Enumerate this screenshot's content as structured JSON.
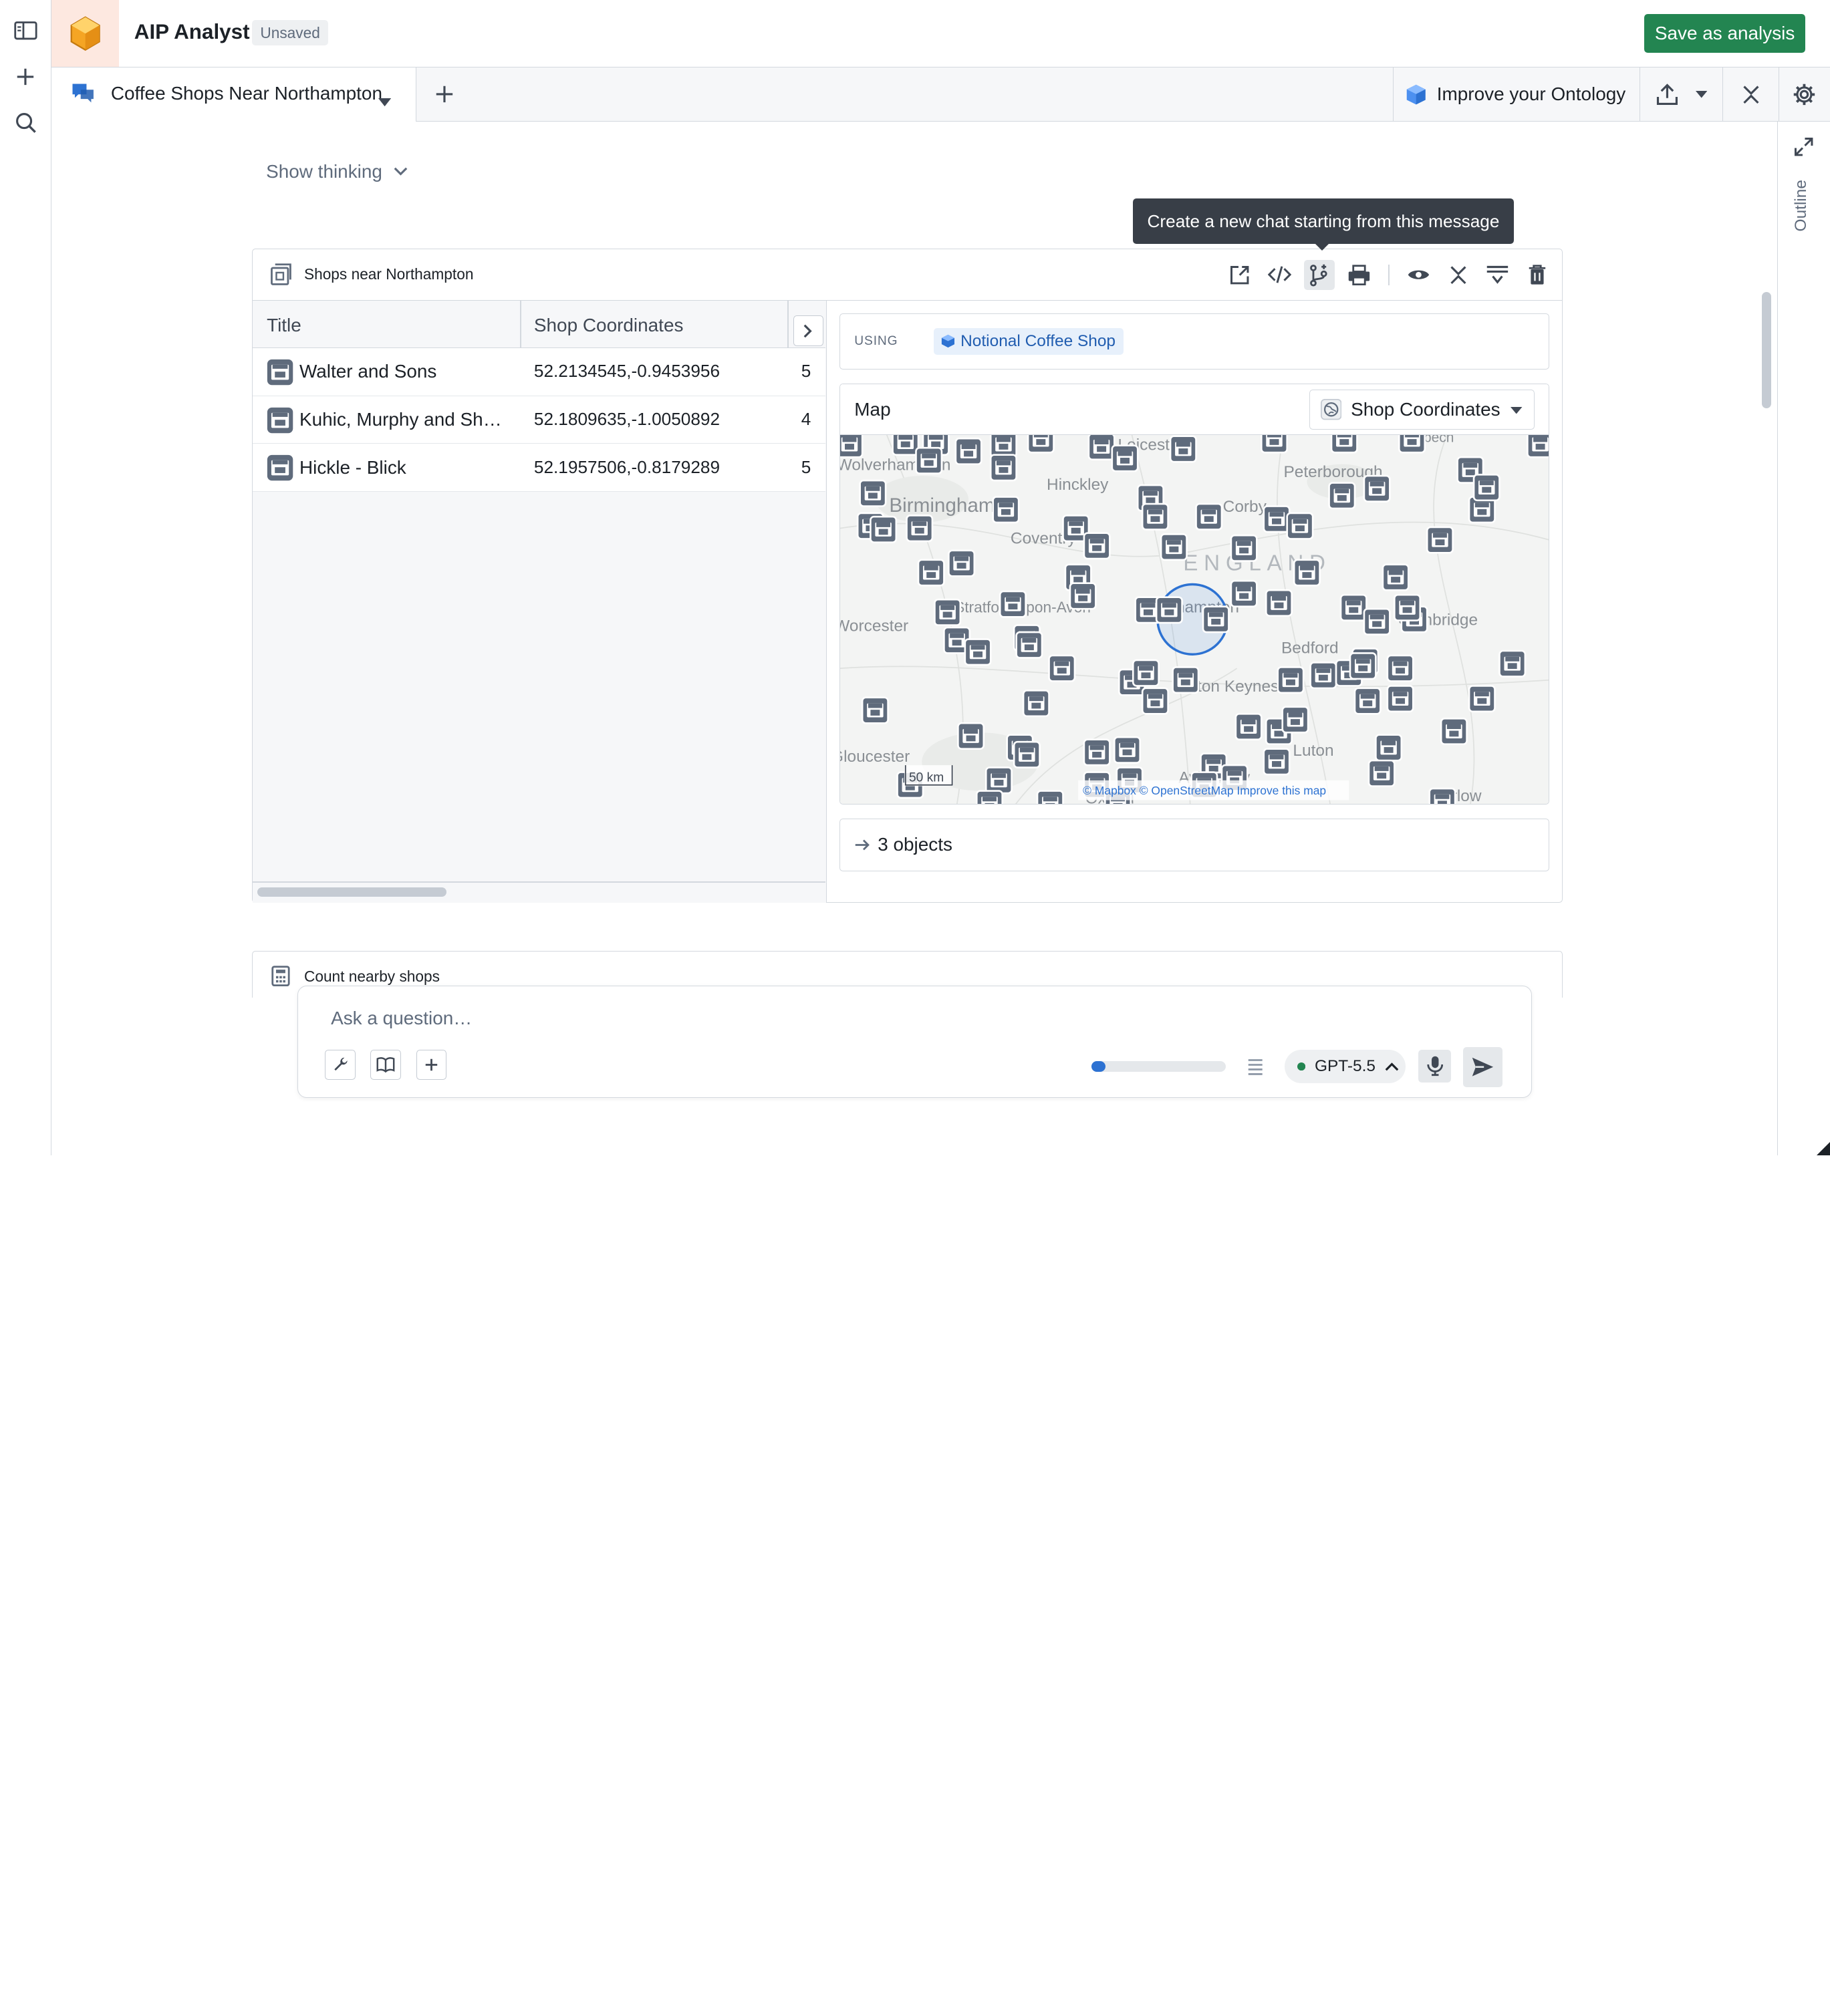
{
  "app": {
    "title": "AIP Analyst",
    "status": "Unsaved",
    "save_label": "Save as analysis"
  },
  "tabs": {
    "active_label": "Coffee Shops Near Northampton",
    "improve_label": "Improve your Ontology"
  },
  "side_panel": {
    "outline_label": "Outline"
  },
  "thinking": {
    "label": "Show thinking"
  },
  "tooltip": {
    "text": "Create a new chat starting from this message"
  },
  "result_card": {
    "title": "Shops near Northampton",
    "columns": [
      "Title",
      "Shop Coordinates"
    ],
    "rows": [
      {
        "title": "Walter and Sons",
        "coords": "52.2134545,-0.9453956",
        "extra": "5"
      },
      {
        "title": "Kuhic, Murphy and Shanahan",
        "coords": "52.1809635,-1.0050892",
        "extra": "4"
      },
      {
        "title": "Hickle - Blick",
        "coords": "52.1957506,-0.8179289",
        "extra": "5"
      }
    ],
    "using_label": "USING",
    "using_value": "Notional Coffee Shop",
    "map_label": "Map",
    "map_property": "Shop Coordinates",
    "map_places": [
      "Wolverhampton",
      "Birmingham",
      "Hinckley",
      "Leicester",
      "Peterborough",
      "Wisbech",
      "Corby",
      "Coventry",
      "ENGLAND",
      "Northampton",
      "Stratford-upon-Avon",
      "Worcester",
      "Bedford",
      "Cambridge",
      "Milton Keynes",
      "Gloucester",
      "Luton",
      "Aylesbury",
      "Harlow",
      "Oxford"
    ],
    "map_scale": "50 km",
    "map_attribution": "© Mapbox © OpenStreetMap Improve this map",
    "objects_label": "3 objects"
  },
  "second_card": {
    "title": "Count nearby shops"
  },
  "composer": {
    "placeholder": "Ask a question…",
    "model": "GPT-5.5",
    "context_usage": 0.1,
    "model_status_color": "#238551"
  },
  "colors": {
    "accent": "#2d72d2",
    "save": "#238551",
    "marker": "#5f6b7c"
  }
}
